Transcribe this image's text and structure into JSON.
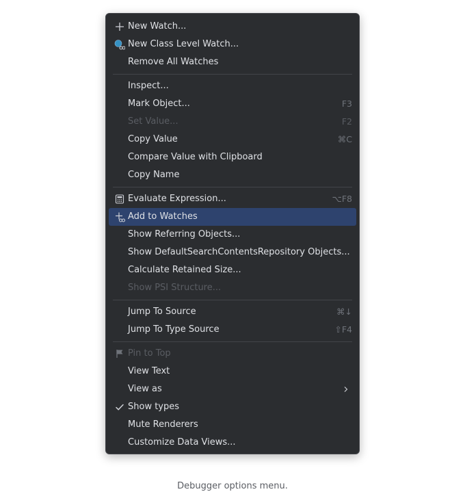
{
  "menu": {
    "groups": [
      [
        {
          "label": "New Watch...",
          "shortcut": "",
          "icon": "plus-icon"
        },
        {
          "label": "New Class Level Watch...",
          "shortcut": "",
          "icon": "class-watch-icon"
        },
        {
          "label": "Remove All Watches",
          "shortcut": ""
        }
      ],
      [
        {
          "label": "Inspect...",
          "shortcut": ""
        },
        {
          "label": "Mark Object...",
          "shortcut": "F3"
        },
        {
          "label": "Set Value...",
          "shortcut": "F2",
          "disabled": true
        },
        {
          "label": "Copy Value",
          "shortcut": "⌘C"
        },
        {
          "label": "Compare Value with Clipboard",
          "shortcut": ""
        },
        {
          "label": "Copy Name",
          "shortcut": ""
        }
      ],
      [
        {
          "label": "Evaluate Expression...",
          "shortcut": "⌥F8",
          "icon": "calculator-icon"
        },
        {
          "label": "Add to Watches",
          "shortcut": "",
          "icon": "add-watch-icon",
          "selected": true
        },
        {
          "label": "Show Referring Objects...",
          "shortcut": ""
        },
        {
          "label": "Show DefaultSearchContentsRepository Objects...",
          "shortcut": ""
        },
        {
          "label": "Calculate Retained Size...",
          "shortcut": ""
        },
        {
          "label": "Show PSI Structure...",
          "shortcut": "",
          "disabled": true
        }
      ],
      [
        {
          "label": "Jump To Source",
          "shortcut": "⌘↓"
        },
        {
          "label": "Jump To Type Source",
          "shortcut": "⇧F4"
        }
      ],
      [
        {
          "label": "Pin to Top",
          "shortcut": "",
          "icon": "flag-icon",
          "disabled": true
        },
        {
          "label": "View Text",
          "shortcut": ""
        },
        {
          "label": "View as",
          "shortcut": "",
          "submenu": true
        },
        {
          "label": "Show types",
          "shortcut": "",
          "icon": "checkmark-icon"
        },
        {
          "label": "Mute Renderers",
          "shortcut": ""
        },
        {
          "label": "Customize Data Views...",
          "shortcut": ""
        }
      ]
    ]
  },
  "caption": "Debugger options menu.",
  "colors": {
    "menu_background": "#2b2d30",
    "selection": "#2e436e",
    "text": "#dfe1e5",
    "disabled_text": "#5a5d63",
    "shortcut_text": "#6f737a"
  }
}
